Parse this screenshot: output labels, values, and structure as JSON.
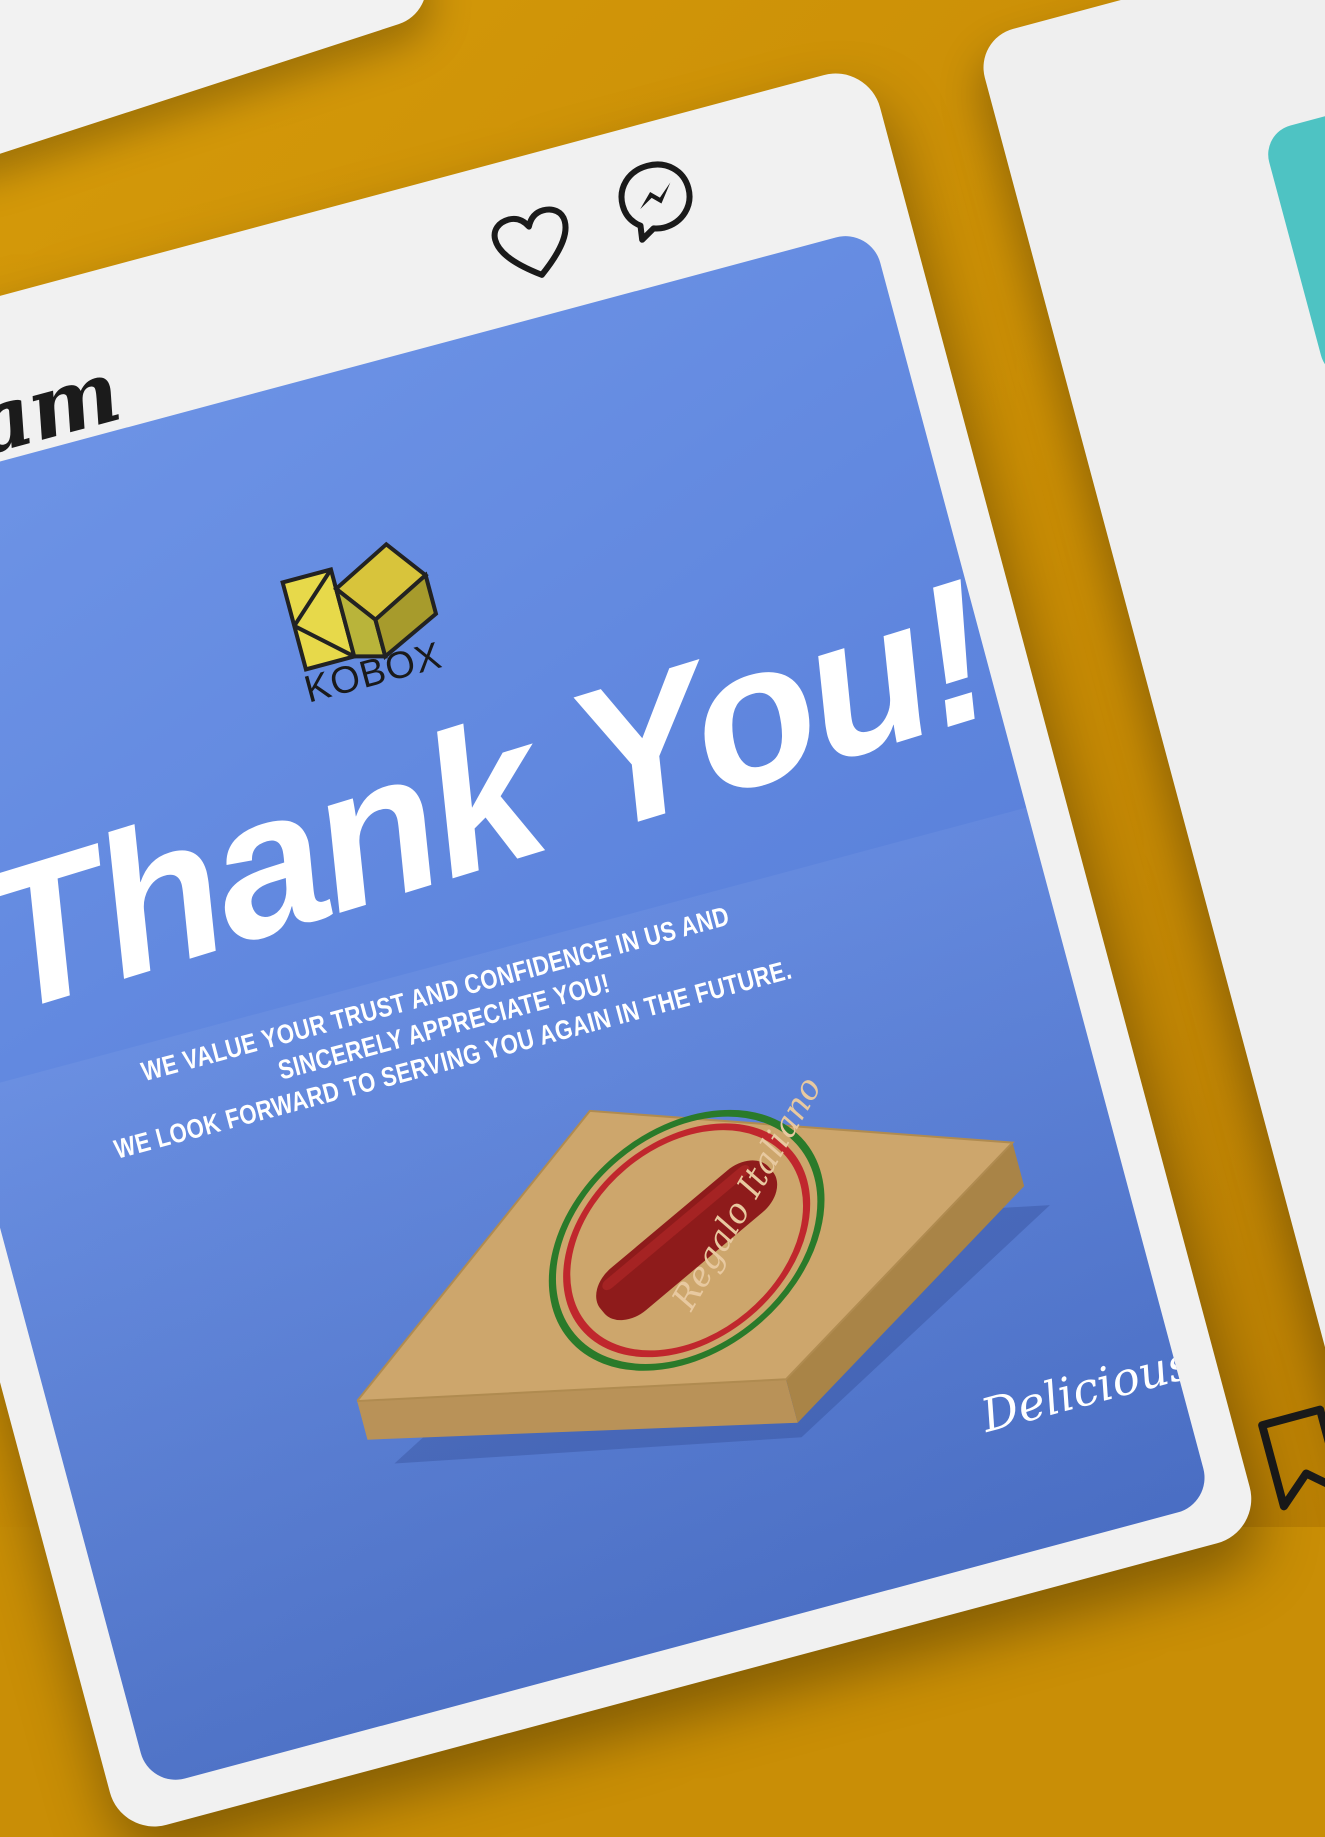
{
  "post": {
    "app_wordmark": "tagram",
    "headline": "Thank You!",
    "message_line1": "WE VALUE YOUR TRUST AND CONFIDENCE IN US AND SINCERELY APPRECIATE YOU!",
    "message_line2": "WE LOOK FORWARD TO SERVING YOU AGAIN IN THE FUTURE.",
    "brand_name": "KOBOX",
    "product_logo_text": "Regalo Italiano",
    "signature": "Delicious Packag"
  },
  "icons": {
    "like": "heart-icon",
    "share": "messenger-icon",
    "save": "bookmark-icon",
    "brand": "kobox-logo"
  },
  "colors": {
    "background": "#c98e06",
    "post_image_bg": "#5f86de",
    "card_bg": "#f1f1f1",
    "teal_card": "#4ec3c3",
    "box_kraft": "#c9a36a",
    "logo_red": "#c0272d",
    "logo_green": "#2a7a2a"
  }
}
